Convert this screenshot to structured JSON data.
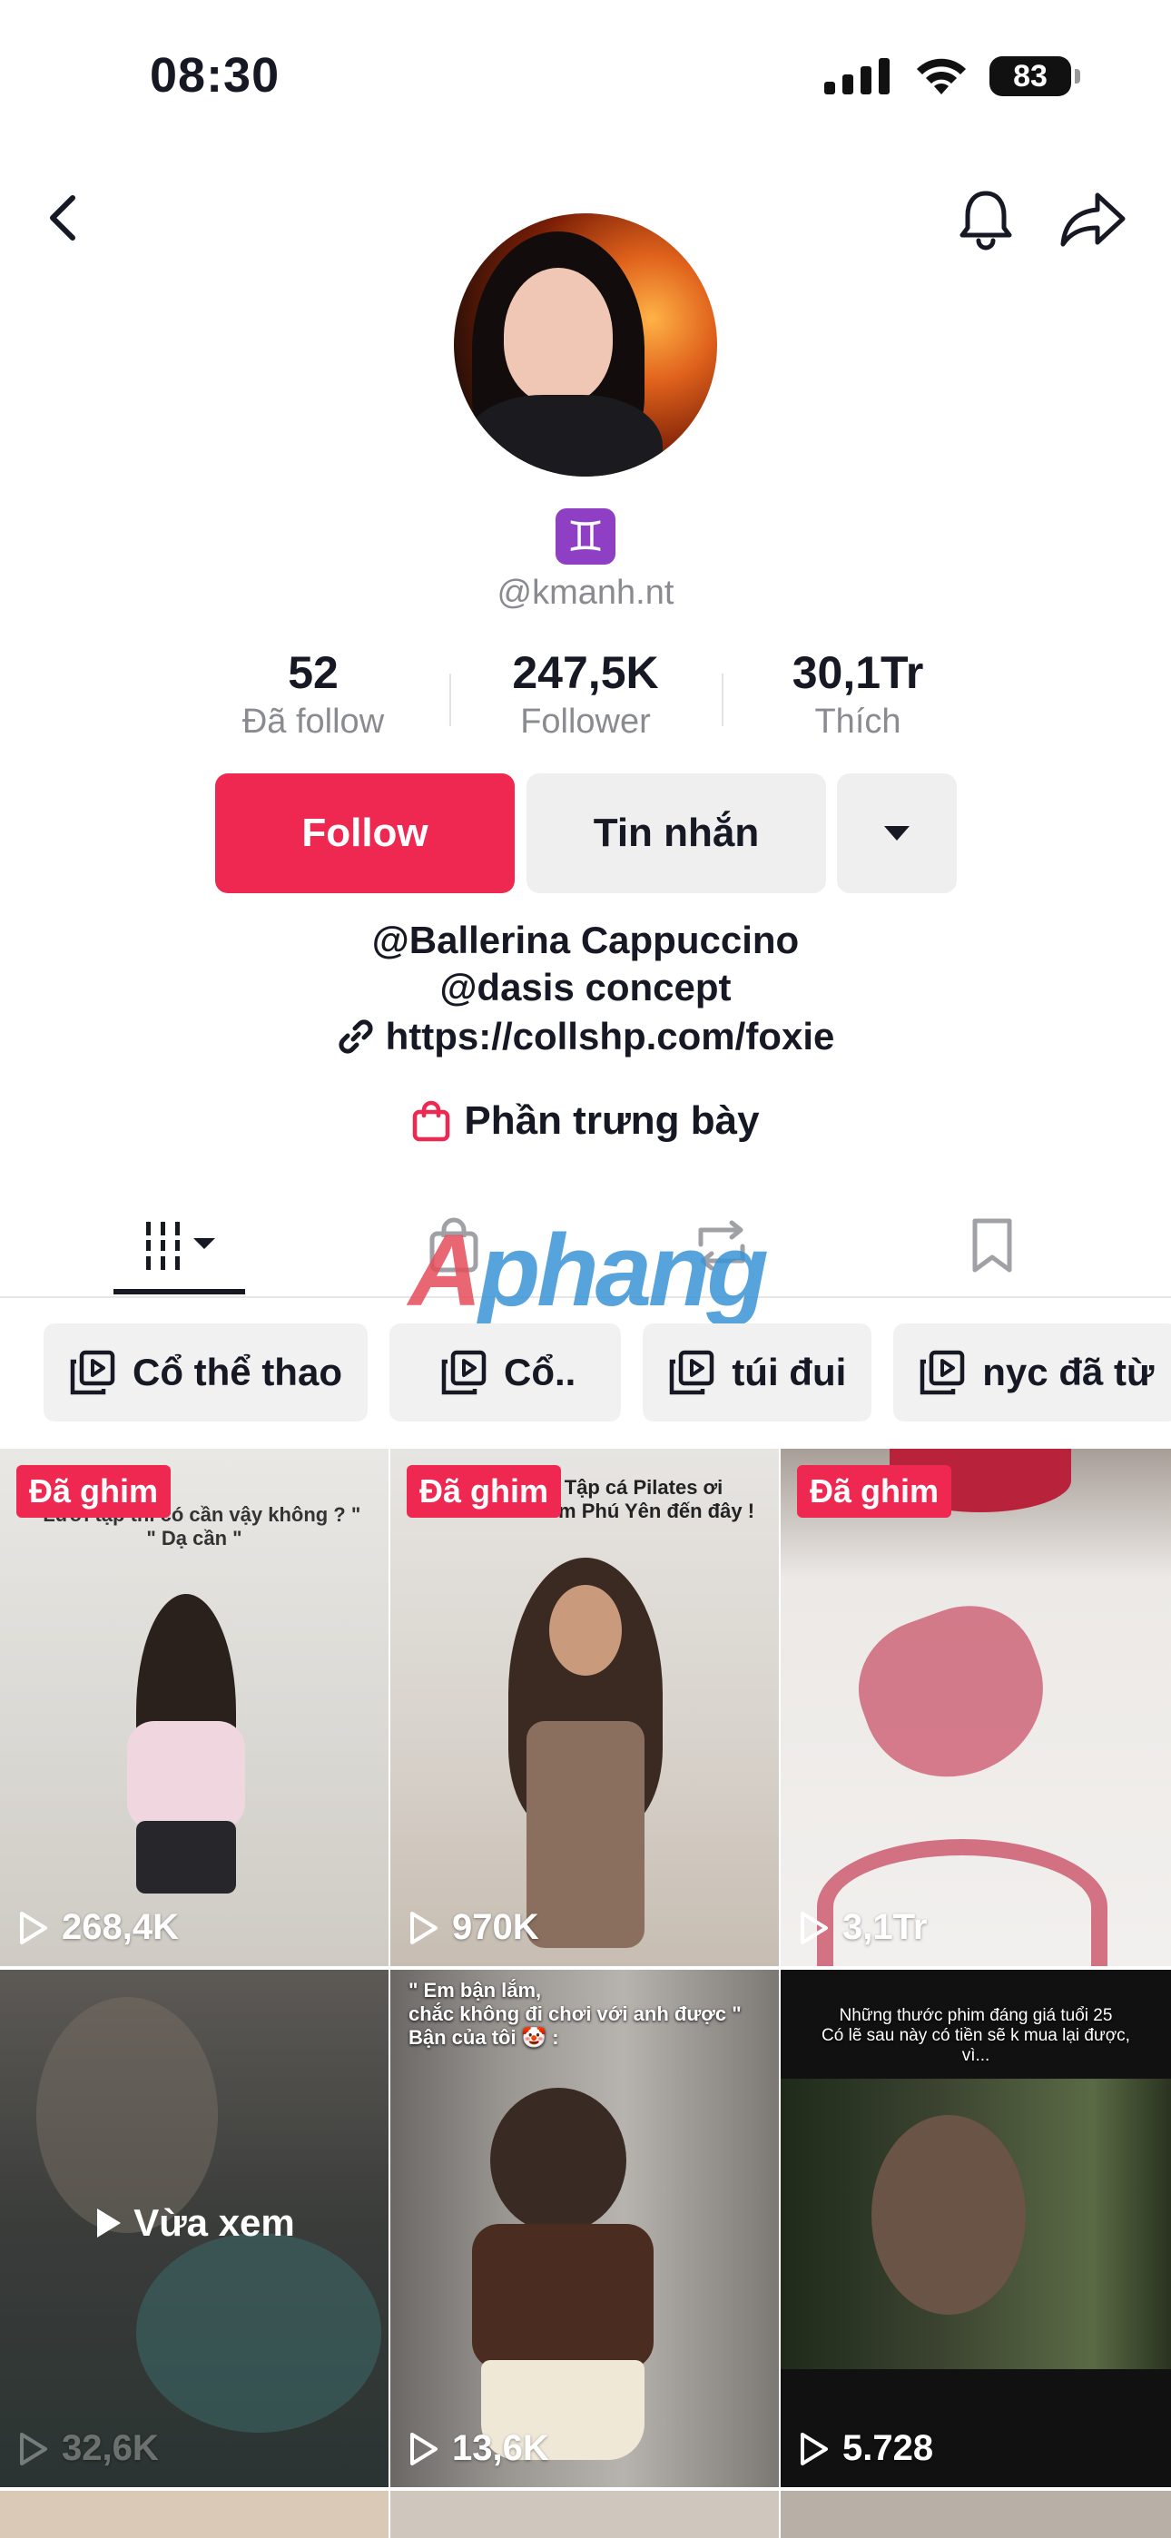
{
  "status_bar": {
    "time": "08:30",
    "battery": "83"
  },
  "profile": {
    "username": "@kmanh.nt",
    "zodiac_symbol": "♊",
    "stats": [
      {
        "value": "52",
        "label": "Đã follow"
      },
      {
        "value": "247,5K",
        "label": "Follower"
      },
      {
        "value": "30,1Tr",
        "label": "Thích"
      }
    ],
    "buttons": {
      "follow": "Follow",
      "message": "Tin nhắn"
    },
    "bio": {
      "line1": "@Ballerina Cappuccino",
      "line2": "@dasis concept",
      "link": "https://collshp.com/foxie"
    },
    "showcase_label": "Phần trưng bày"
  },
  "watermark": {
    "part1": "A",
    "part2": "phang"
  },
  "playlists": [
    "Cổ thể thao",
    "Cổ..",
    "túi đui",
    "nyc đã từ"
  ],
  "videos": [
    {
      "pinned": true,
      "pin_label": "Đã ghim",
      "views": "268,4K",
      "caption": "\" Lười tập thì có cần vậy không ? \" \n \" Dạ cần \""
    },
    {
      "pinned": true,
      "pin_label": "Đã ghim",
      "views": "970K",
      "caption": "Tập cá Pilates ơi \n Đem Phú Yên đến đây !"
    },
    {
      "pinned": true,
      "pin_label": "Đã ghim",
      "views": "3,1Tr",
      "caption": ""
    },
    {
      "pinned": false,
      "views": "32,6K",
      "watched_label": "Vừa xem",
      "caption": ""
    },
    {
      "pinned": false,
      "views": "13,6K",
      "caption": "\" Em bận lắm, \n chắc không đi chơi với anh được \" \n Bận của tôi 🤡 :"
    },
    {
      "pinned": false,
      "views": "5.728",
      "caption": "Những thước phim đáng giá tuổi 25 \n Có lẽ sau này có tiền sẽ k mua lại được, \n vì..."
    }
  ],
  "colors": {
    "accent": "#ef2851",
    "muted": "#8a8b91",
    "button_bg": "#efeff0"
  }
}
